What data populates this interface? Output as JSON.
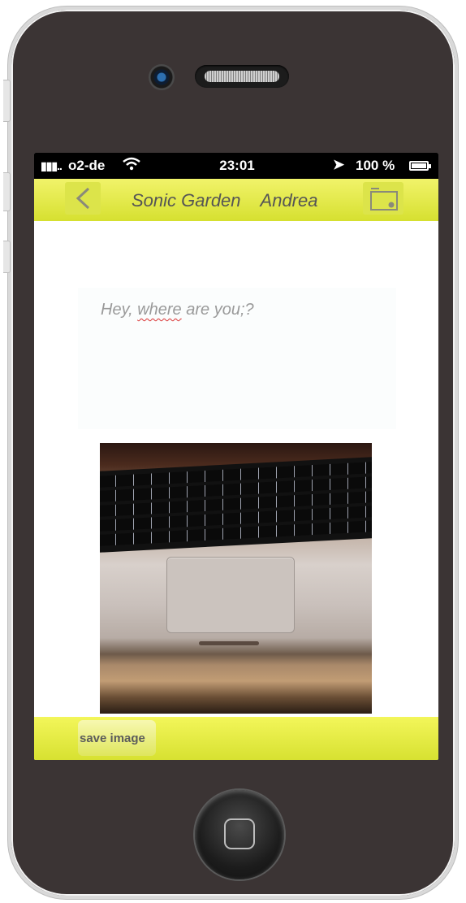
{
  "statusbar": {
    "carrier": "o2-de",
    "time": "23:01",
    "battery": "100 %",
    "icons": [
      "signal-icon",
      "wifi-icon",
      "location-arrow-icon",
      "battery-icon"
    ]
  },
  "navbar": {
    "title_part1": "Sonic Garden",
    "title_part2": "Andrea",
    "icons": [
      "back-chevron-icon",
      "folder-icon"
    ]
  },
  "message": {
    "prefix": "Hey, ",
    "misspelled_word": "where",
    "suffix": " are you;?"
  },
  "bottombar": {
    "save_label": "save image"
  },
  "colors": {
    "accent_yellow": "#e3ea3f",
    "status_bar": "#000000",
    "phone_body": "#3b3434"
  }
}
